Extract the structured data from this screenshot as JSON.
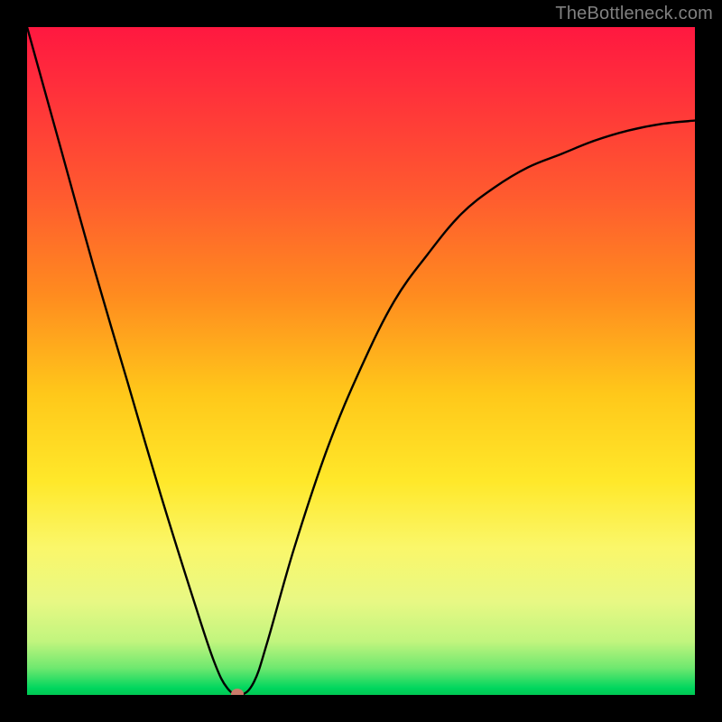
{
  "watermark": "TheBottleneck.com",
  "colors": {
    "frame_bg": "#000000",
    "gradient_top": "#ff1840",
    "gradient_mid": "#ffd21a",
    "gradient_bottom": "#00c853",
    "curve_stroke": "#000000",
    "dot_fill": "#c97b6a",
    "watermark": "#808080"
  },
  "chart_data": {
    "type": "line",
    "title": "",
    "xlabel": "",
    "ylabel": "",
    "xlim": [
      0,
      100
    ],
    "ylim": [
      0,
      100
    ],
    "grid": false,
    "legend": false,
    "series": [
      {
        "name": "bottleneck-curve",
        "x": [
          0,
          5,
          10,
          15,
          20,
          25,
          28,
          30,
          32,
          34,
          36,
          40,
          45,
          50,
          55,
          60,
          65,
          70,
          75,
          80,
          85,
          90,
          95,
          100
        ],
        "y": [
          100,
          82,
          64,
          47,
          30,
          14,
          5,
          1,
          0,
          2,
          8,
          22,
          37,
          49,
          59,
          66,
          72,
          76,
          79,
          81,
          83,
          84.5,
          85.5,
          86
        ]
      }
    ],
    "annotations": [
      {
        "type": "dot",
        "name": "min-marker",
        "x": 31.5,
        "y": 0,
        "color": "#c97b6a"
      }
    ],
    "background": {
      "type": "vertical-gradient",
      "stops": [
        {
          "pos": 0.0,
          "color": "#ff1840"
        },
        {
          "pos": 0.4,
          "color": "#ff8b1f"
        },
        {
          "pos": 0.68,
          "color": "#ffe82a"
        },
        {
          "pos": 0.92,
          "color": "#c1f57e"
        },
        {
          "pos": 1.0,
          "color": "#00c853"
        }
      ]
    }
  }
}
